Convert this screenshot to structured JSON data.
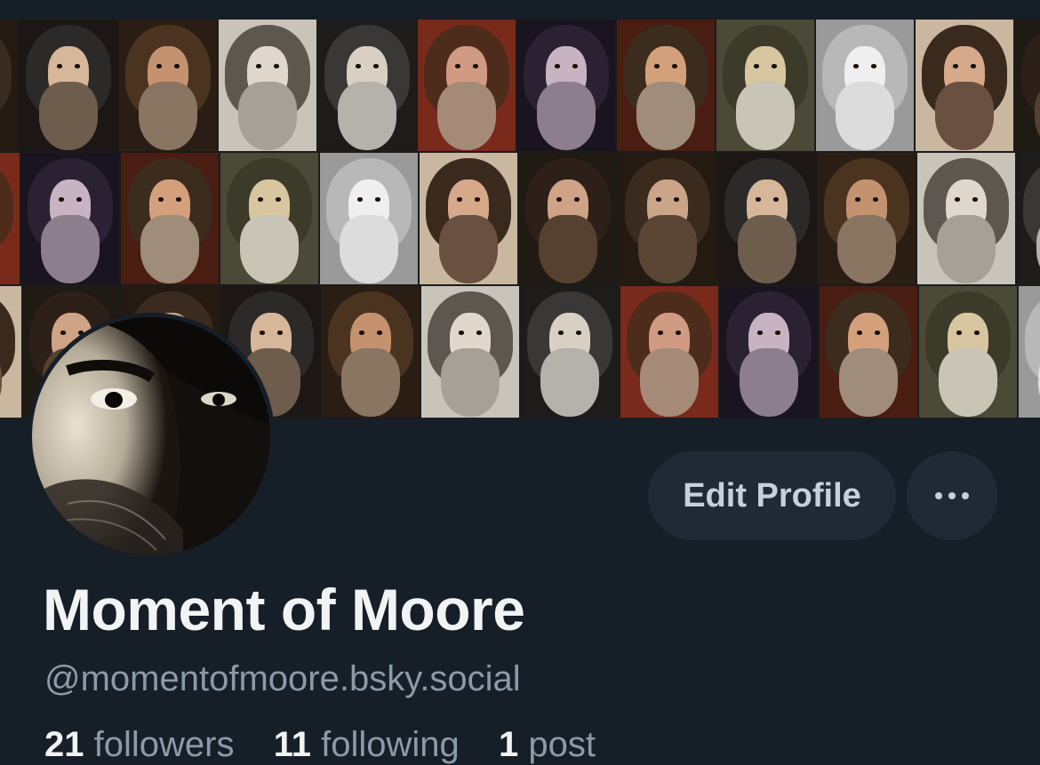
{
  "profile": {
    "display_name": "Moment of Moore",
    "handle": "@momentofmoore.bsky.social",
    "edit_button_label": "Edit Profile",
    "more_button_icon": "more-horizontal-icon"
  },
  "stats": {
    "followers_count": "21",
    "followers_label": "followers",
    "following_count": "11",
    "following_label": "following",
    "posts_count": "1",
    "posts_label": "post"
  },
  "colors": {
    "background": "#161e27",
    "button_background": "#1f2a36",
    "button_text": "#c6d1dc",
    "primary_text": "#f1f3f5",
    "secondary_text": "#8c9aa8"
  }
}
